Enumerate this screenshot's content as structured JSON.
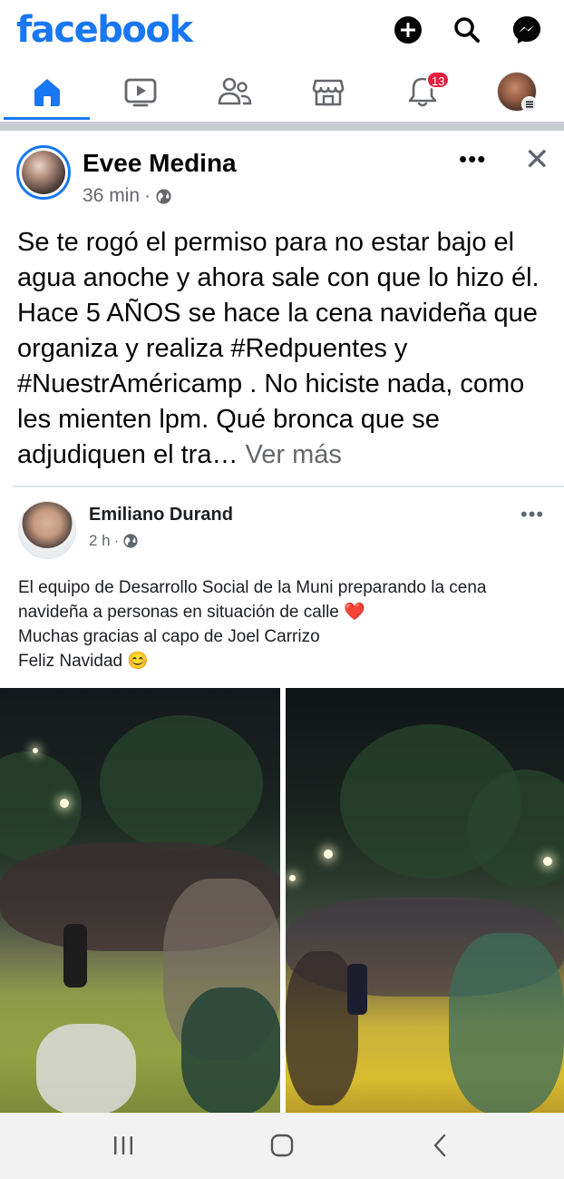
{
  "app": {
    "logo": "facebook",
    "brand_color": "#1877f2"
  },
  "top_icons": [
    "plus-circle-icon",
    "search-icon",
    "messenger-icon"
  ],
  "nav": {
    "tabs": [
      {
        "name": "home",
        "icon": "home-icon",
        "active": true
      },
      {
        "name": "watch",
        "icon": "video-icon",
        "active": false
      },
      {
        "name": "friends",
        "icon": "friends-icon",
        "active": false
      },
      {
        "name": "marketplace",
        "icon": "marketplace-icon",
        "active": false
      },
      {
        "name": "notifications",
        "icon": "bell-icon",
        "active": false
      },
      {
        "name": "menu",
        "icon": "profile-menu-icon",
        "active": false
      }
    ],
    "notification_badge": "13"
  },
  "post": {
    "author": "Evee Medina",
    "time": "36 min",
    "meta_sep": "·",
    "text": "Se te rogó el permiso para no estar bajo el agua anoche y ahora sale con que lo hizo él. Hace 5 AÑOS se hace la cena navideña que organiza y realiza #Redpuentes y #NuestrAméricamp . No hiciste nada, como les mienten lpm. Qué bronca que se adjudiquen el tra…",
    "see_more": " Ver más",
    "more": "•••",
    "close": "✕"
  },
  "shared_post": {
    "author": "Emiliano Durand",
    "time": "2 h",
    "meta_sep": "·",
    "more": "•••",
    "line1": "El equipo de Desarrollo Social de la Muni preparando la cena navideña a personas en situación de calle",
    "line1_emoji": "❤️",
    "line2": "Muchas gracias al capo de Joel Carrizo",
    "line3": "Feliz Navidad",
    "line3_emoji": "😊"
  },
  "android_nav": {
    "recent": "recent-apps-icon",
    "home": "home-button-icon",
    "back": "back-icon"
  }
}
